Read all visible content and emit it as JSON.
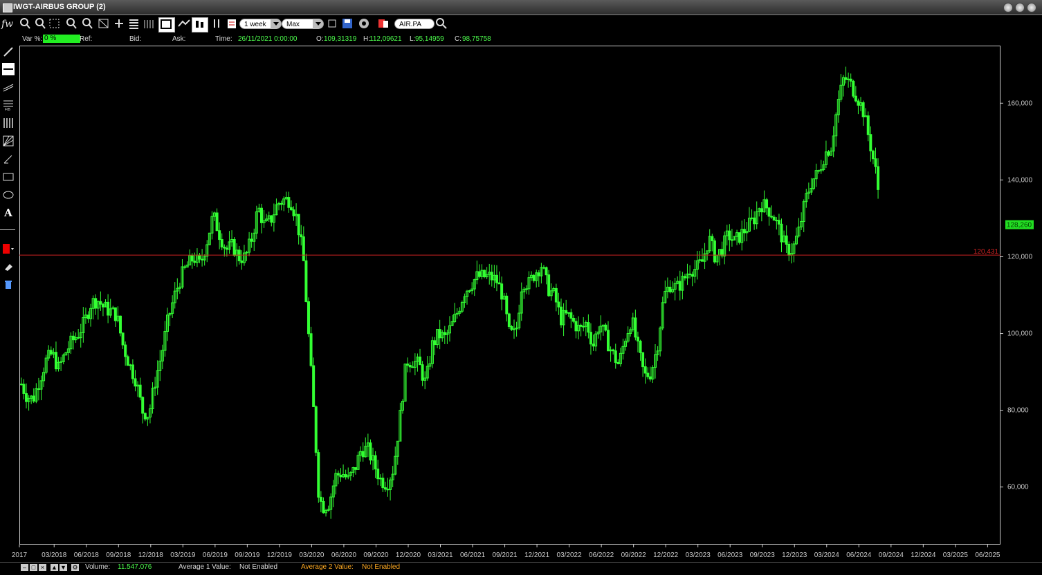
{
  "window": {
    "title": "IWGT-AIRBUS GROUP (2)"
  },
  "toolbar": {
    "logo_text": "fw",
    "period": "1 week",
    "range": "Max",
    "symbol": "AIR.PA"
  },
  "infobar": {
    "var_label": "Var %:",
    "var_value": "0 %",
    "ref_label": "Ref:",
    "bid_label": "Bid:",
    "ask_label": "Ask:",
    "time_label": "Time:",
    "time_value": "26/11/2021 0:00:00",
    "open_label": "O:",
    "open_value": "109,31319",
    "high_label": "H:",
    "high_value": "112,09621",
    "low_label": "L:",
    "low_value": "95,14959",
    "close_label": "C:",
    "close_value": "98,75758"
  },
  "chart_data": {
    "type": "line",
    "style": "candlestick",
    "ylim": [
      45,
      175
    ],
    "y_ticks": [
      "60,000",
      "80,000",
      "100,000",
      "120,000",
      "140,000",
      "160,000"
    ],
    "y_tick_values": [
      60,
      80,
      100,
      120,
      140,
      160
    ],
    "x_ticks": [
      "2017",
      "03/2018",
      "06/2018",
      "09/2018",
      "12/2018",
      "03/2019",
      "06/2019",
      "09/2019",
      "12/2019",
      "03/2020",
      "06/2020",
      "09/2020",
      "12/2020",
      "03/2021",
      "06/2021",
      "09/2021",
      "12/2021",
      "03/2022",
      "06/2022",
      "09/2022",
      "12/2022",
      "03/2023",
      "06/2023",
      "09/2023",
      "12/2023",
      "03/2024",
      "06/2024",
      "09/2024",
      "12/2024",
      "03/2025",
      "06/2025"
    ],
    "x_tick_values": [
      2017.9,
      2018.17,
      2018.42,
      2018.67,
      2018.92,
      2019.17,
      2019.42,
      2019.67,
      2019.92,
      2020.17,
      2020.42,
      2020.67,
      2020.92,
      2021.17,
      2021.42,
      2021.67,
      2021.92,
      2022.17,
      2022.42,
      2022.67,
      2022.92,
      2023.17,
      2023.42,
      2023.67,
      2023.92,
      2024.17,
      2024.42,
      2024.67,
      2024.92,
      2025.17,
      2025.42
    ],
    "xlim": [
      2017.9,
      2025.52
    ],
    "last_price": "128,260",
    "last_value": 128.26,
    "reference_line": "120,431",
    "reference_value": 120.431,
    "series": [
      {
        "color": "#33ff33",
        "x": [
          2017.91,
          2017.95,
          2018.0,
          2018.05,
          2018.1,
          2018.15,
          2018.2,
          2018.25,
          2018.3,
          2018.35,
          2018.4,
          2018.45,
          2018.5,
          2018.55,
          2018.6,
          2018.65,
          2018.7,
          2018.75,
          2018.8,
          2018.85,
          2018.9,
          2018.95,
          2019.0,
          2019.05,
          2019.1,
          2019.15,
          2019.2,
          2019.25,
          2019.3,
          2019.35,
          2019.4,
          2019.45,
          2019.5,
          2019.55,
          2019.6,
          2019.65,
          2019.7,
          2019.75,
          2019.8,
          2019.85,
          2019.9,
          2019.95,
          2020.0,
          2020.05,
          2020.1,
          2020.13,
          2020.16,
          2020.19,
          2020.22,
          2020.25,
          2020.3,
          2020.35,
          2020.4,
          2020.45,
          2020.5,
          2020.55,
          2020.6,
          2020.65,
          2020.7,
          2020.75,
          2020.8,
          2020.85,
          2020.9,
          2020.95,
          2021.0,
          2021.05,
          2021.1,
          2021.15,
          2021.2,
          2021.25,
          2021.3,
          2021.35,
          2021.4,
          2021.45,
          2021.5,
          2021.55,
          2021.6,
          2021.65,
          2021.7,
          2021.75,
          2021.8,
          2021.85,
          2021.9,
          2021.95,
          2022.0,
          2022.05,
          2022.1,
          2022.15,
          2022.2,
          2022.25,
          2022.3,
          2022.35,
          2022.4,
          2022.45,
          2022.5,
          2022.55,
          2022.6,
          2022.65,
          2022.7,
          2022.75,
          2022.8,
          2022.85,
          2022.9,
          2022.95,
          2023.0,
          2023.05,
          2023.1,
          2023.15,
          2023.2,
          2023.25,
          2023.3,
          2023.35,
          2023.4,
          2023.45,
          2023.5,
          2023.55,
          2023.6,
          2023.65,
          2023.7,
          2023.75,
          2023.8,
          2023.85,
          2023.9,
          2023.95,
          2024.0,
          2024.05,
          2024.1,
          2024.15,
          2024.2,
          2024.25,
          2024.3,
          2024.35,
          2024.4,
          2024.45,
          2024.5,
          2024.53,
          2024.56,
          2024.58
        ],
        "values": [
          87,
          84,
          83,
          88,
          93,
          95,
          91,
          95,
          98,
          100,
          103,
          108,
          109,
          107,
          106,
          105,
          97,
          92,
          88,
          80,
          79,
          88,
          95,
          104,
          110,
          115,
          118,
          120,
          118,
          124,
          131,
          126,
          122,
          123,
          120,
          120,
          125,
          133,
          128,
          130,
          134,
          135,
          135,
          130,
          120,
          105,
          90,
          75,
          58,
          55,
          56,
          63,
          64,
          62,
          65,
          70,
          70,
          66,
          62,
          61,
          65,
          78,
          93,
          93,
          92,
          87,
          97,
          100,
          99,
          102,
          106,
          111,
          113,
          115,
          115,
          115,
          114,
          110,
          100,
          100,
          114,
          113,
          116,
          118,
          112,
          110,
          104,
          105,
          103,
          101,
          103,
          97,
          103,
          99,
          95,
          92,
          99,
          104,
          96,
          89,
          90,
          97,
          110,
          113,
          112,
          114,
          117,
          117,
          119,
          125,
          120,
          122,
          126,
          124,
          126,
          128,
          130,
          134,
          133,
          131,
          127,
          122,
          122,
          127,
          135,
          140,
          142,
          147,
          149,
          160,
          167,
          165,
          162,
          158,
          150,
          145,
          140,
          128.26
        ]
      }
    ]
  },
  "bottombar": {
    "volume_label": "Volume:",
    "volume_value": "11.547.076",
    "avg1_label": "Average 1 Value:",
    "avg1_value": "Not Enabled",
    "avg2_label": "Average 2 Value:",
    "avg2_value": "Not Enabled"
  },
  "colors": {
    "candle": "#33ff33",
    "reference": "#cc2222",
    "label_green": "#4dff4d",
    "label_orange": "#ffaa22",
    "last_price_bg": "#22dd22"
  }
}
